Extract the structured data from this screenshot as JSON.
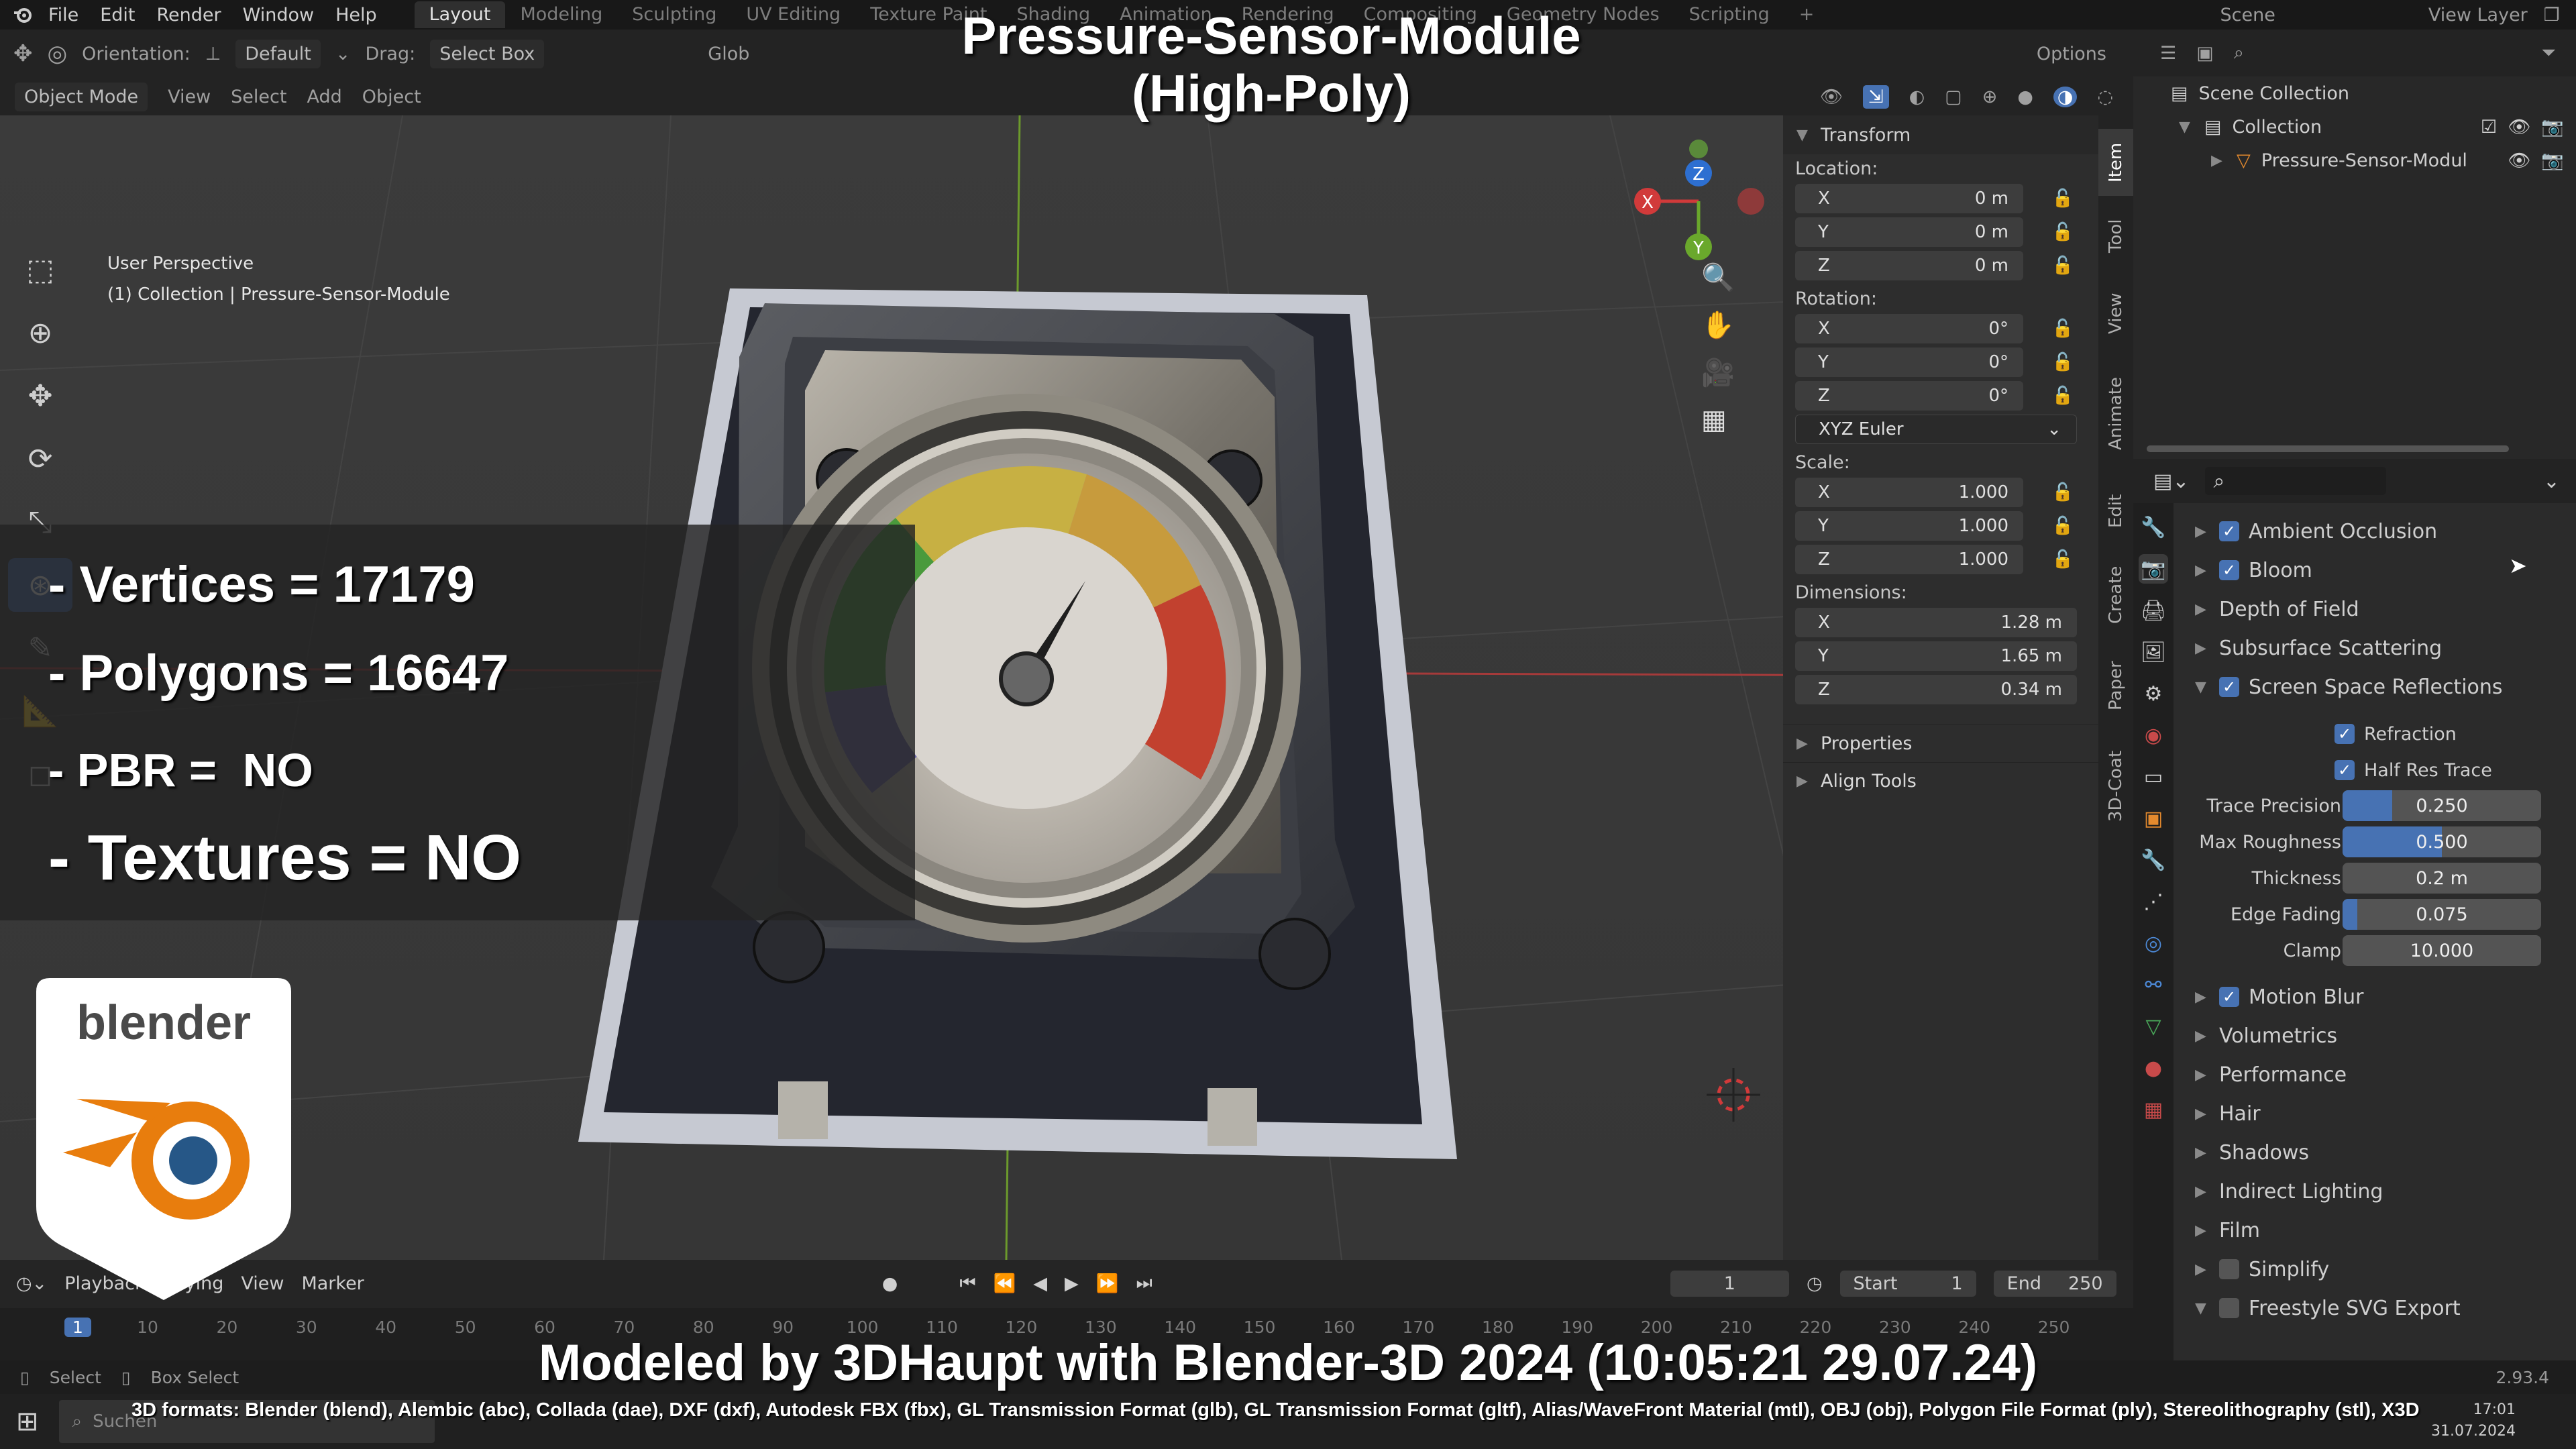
{
  "menu": {
    "items": [
      "File",
      "Edit",
      "Render",
      "Window",
      "Help"
    ],
    "workspaces": [
      "Layout",
      "Modeling",
      "Sculpting",
      "UV Editing",
      "Texture Paint",
      "Shading",
      "Animation",
      "Rendering",
      "Compositing",
      "Geometry Nodes",
      "Scripting"
    ],
    "active_workspace": "Layout",
    "scene": "Scene",
    "view_layer": "View Layer"
  },
  "header": {
    "orientation_label": "Orientation:",
    "orientation_value": "Default",
    "drag_label": "Drag:",
    "drag_value": "Select Box",
    "transform_space": "Glob",
    "options": "Options",
    "mode": "Object Mode",
    "menus": [
      "View",
      "Select",
      "Add",
      "Object"
    ]
  },
  "viewport": {
    "perspective": "User Perspective",
    "collection_line": "(1) Collection | Pressure-Sensor-Module",
    "gizmo": {
      "x": "X",
      "y": "Y",
      "z": "Z"
    }
  },
  "overlay": {
    "title_line1": "Pressure-Sensor-Module",
    "title_line2": "(High-Poly)",
    "vertices": "- Vertices = 17179",
    "polygons": "- Polygons = 16647",
    "pbr": "- PBR =  NO",
    "textures": "- Textures = NO",
    "logo_text": "blender",
    "credit": "Modeled by 3DHaupt with Blender-3D 2024 (10:05:21  29.07.24)",
    "formats": "3D formats: Blender (blend), Alembic (abc), Collada (dae), DXF (dxf), Autodesk FBX (fbx), GL Transmission Format (glb), GL Transmission Format (gltf), Alias/WaveFront Material (mtl), OBJ (obj), Polygon File Format (ply), Stereolithography (stl), X3D"
  },
  "npanel": {
    "transform": "Transform",
    "location": "Location:",
    "loc": [
      {
        "axis": "X",
        "value": "0 m"
      },
      {
        "axis": "Y",
        "value": "0 m"
      },
      {
        "axis": "Z",
        "value": "0 m"
      }
    ],
    "rotation": "Rotation:",
    "rot": [
      {
        "axis": "X",
        "value": "0°"
      },
      {
        "axis": "Y",
        "value": "0°"
      },
      {
        "axis": "Z",
        "value": "0°"
      }
    ],
    "rotation_mode": "XYZ Euler",
    "scale": "Scale:",
    "scl": [
      {
        "axis": "X",
        "value": "1.000"
      },
      {
        "axis": "Y",
        "value": "1.000"
      },
      {
        "axis": "Z",
        "value": "1.000"
      }
    ],
    "dimensions": "Dimensions:",
    "dim": [
      {
        "axis": "X",
        "value": "1.28 m"
      },
      {
        "axis": "Y",
        "value": "1.65 m"
      },
      {
        "axis": "Z",
        "value": "0.34 m"
      }
    ],
    "properties": "Properties",
    "align_tools": "Align Tools",
    "tabs": [
      "Item",
      "Tool",
      "View",
      "Animate",
      "Edit",
      "Create",
      "Paper",
      "3D-Coat"
    ]
  },
  "outliner": {
    "scene_collection": "Scene Collection",
    "collection": "Collection",
    "object": "Pressure-Sensor-Modul"
  },
  "props": {
    "ambient_occlusion": "Ambient Occlusion",
    "bloom": "Bloom",
    "depth_of_field": "Depth of Field",
    "subsurface": "Subsurface Scattering",
    "ssr": "Screen Space Reflections",
    "refraction": "Refraction",
    "half_res": "Half Res Trace",
    "trace_precision": {
      "label": "Trace Precision",
      "value": "0.250",
      "fraction": 0.25
    },
    "max_roughness": {
      "label": "Max Roughness",
      "value": "0.500",
      "fraction": 0.5
    },
    "thickness": {
      "label": "Thickness",
      "value": "0.2 m",
      "fraction": 0.0
    },
    "edge_fading": {
      "label": "Edge Fading",
      "value": "0.075",
      "fraction": 0.075
    },
    "clamp": {
      "label": "Clamp",
      "value": "10.000",
      "fraction": 0.0
    },
    "motion_blur": "Motion Blur",
    "volumetrics": "Volumetrics",
    "performance": "Performance",
    "hair": "Hair",
    "shadows": "Shadows",
    "indirect": "Indirect Lighting",
    "film": "Film",
    "simplify": "Simplify",
    "freestyle": "Freestyle SVG Export"
  },
  "timeline": {
    "playback": "Playback",
    "keying": "Keying",
    "view": "View",
    "marker": "Marker",
    "current_frame": "1",
    "start_label": "Start",
    "start": "1",
    "end_label": "End",
    "end": "250",
    "ruler": [
      "1",
      "10",
      "20",
      "30",
      "40",
      "50",
      "60",
      "70",
      "80",
      "90",
      "100",
      "110",
      "120",
      "130",
      "140",
      "150",
      "160",
      "170",
      "180",
      "190",
      "200",
      "210",
      "220",
      "230",
      "240",
      "250"
    ]
  },
  "status": {
    "select": "Select",
    "box_select": "Box Select",
    "version": "2.93.4",
    "search": "Suchen",
    "time": "17:01",
    "date": "31.07.2024"
  }
}
